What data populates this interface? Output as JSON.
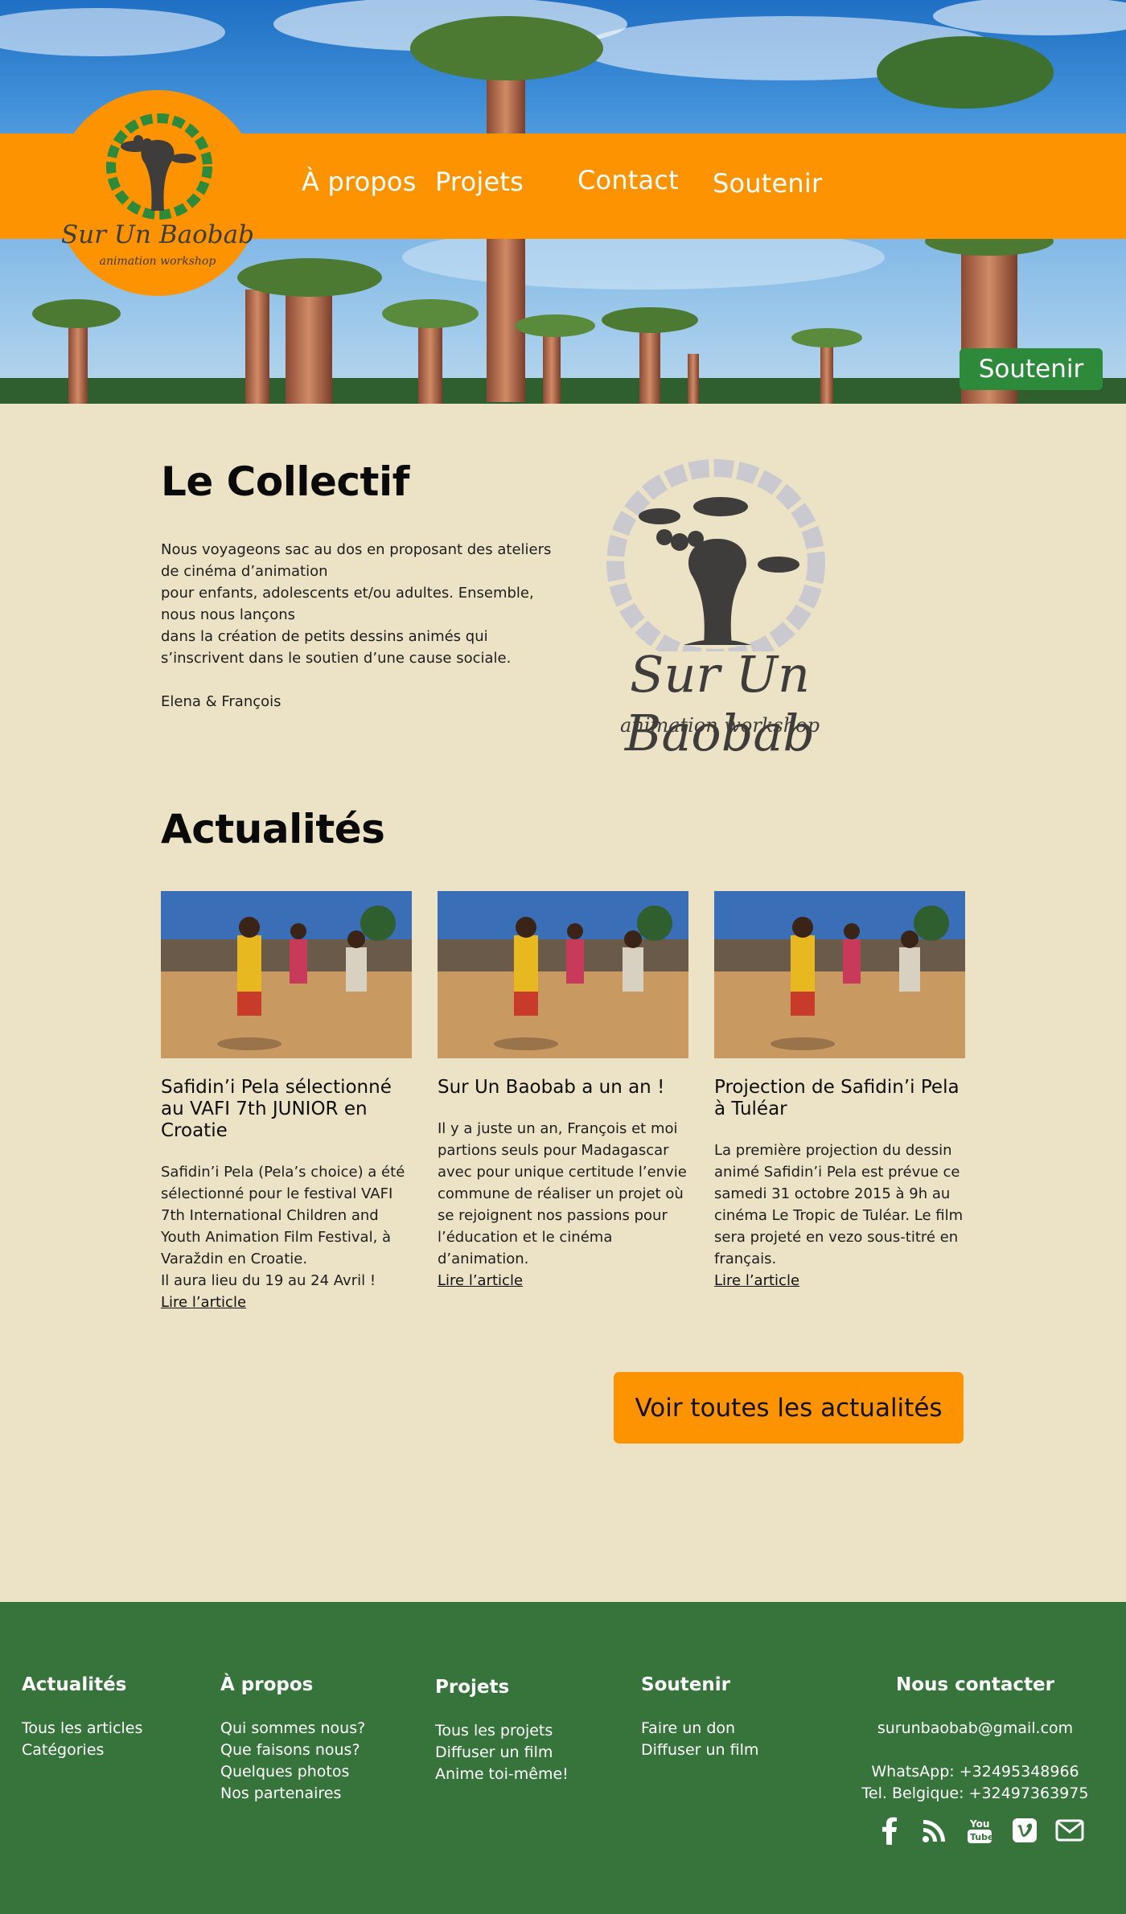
{
  "brand": {
    "logo_line1": "Sur Un Baobab",
    "logo_line2": "animation workshop",
    "orange": "#fd9300",
    "green": "#37743b",
    "beige": "#ece3c6"
  },
  "nav": {
    "items": [
      "À propos",
      "Projets",
      "Contact",
      "Soutenir"
    ]
  },
  "hero": {
    "support_button": "Soutenir"
  },
  "collectif": {
    "title": "Le Collectif",
    "lines": [
      "Nous voyageons sac au dos en proposant des ateliers de cinéma d’animation",
      "pour enfants, adolescents et/ou adultes. Ensemble, nous nous lançons",
      "dans la création de petits dessins animés qui s’inscrivent dans le soutien d’une cause sociale."
    ],
    "signature": "Elena & François"
  },
  "news": {
    "title": "Actualités",
    "read_more": "Lire l’article",
    "all_button": "Voir toutes les actualités",
    "articles": [
      {
        "title": "Safidin’i Pela sélectionné au VAFI 7th JUNIOR en Croatie",
        "body": "Safidin’i Pela (Pela’s choice) a été sélectionné pour le festival VAFI 7th International Children and Youth Animation Film Festival, à Varaždin en Croatie.",
        "body2": "Il aura lieu du 19 au 24 Avril !"
      },
      {
        "title": "Sur Un Baobab a un an !",
        "body": "Il y a juste un an, François et moi partions seuls pour Madagascar avec pour unique certitude l’envie commune de réaliser un projet où se rejoignent nos passions pour l’éducation et le cinéma d’animation.",
        "body2": ""
      },
      {
        "title": "Projection de Safidin’i Pela à Tuléar",
        "body": "La première projection du dessin animé Safidin’i Pela est prévue ce samedi 31 octobre 2015 à 9h au cinéma Le Tropic de Tuléar. Le film sera projeté en vezo sous-titré en français.",
        "body2": ""
      }
    ]
  },
  "footer": {
    "cols": [
      {
        "title": "Actualités",
        "links": [
          "Tous les articles",
          "Catégories"
        ]
      },
      {
        "title": "À propos",
        "links": [
          "Qui sommes nous?",
          "Que faisons nous?",
          "Quelques photos",
          "Nos partenaires"
        ]
      },
      {
        "title": "Projets",
        "links": [
          "Tous les projets",
          "Diffuser un film",
          "Anime toi-même!"
        ]
      },
      {
        "title": "Soutenir",
        "links": [
          "Faire un don",
          "Diffuser un film"
        ]
      }
    ],
    "contact": {
      "title": "Nous contacter",
      "email": "surunbaobab@gmail.com",
      "whatsapp": "WhatsApp: +32495348966",
      "tel": "Tel. Belgique: +32497363975"
    },
    "social_icons": [
      "facebook-icon",
      "rss-icon",
      "youtube-icon",
      "vimeo-icon",
      "mail-icon"
    ]
  }
}
